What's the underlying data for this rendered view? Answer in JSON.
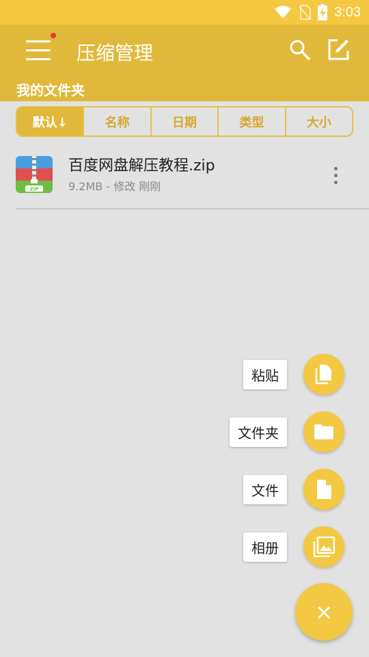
{
  "status_bar": {
    "time": "3:03",
    "icons": [
      "wifi-icon",
      "no-sim-icon",
      "battery-charging-icon"
    ]
  },
  "toolbar": {
    "title": "压缩管理",
    "icons": [
      "menu-icon",
      "search-icon",
      "edit-icon"
    ],
    "has_notification_dot": true
  },
  "breadcrumb": {
    "label": "我的文件夹"
  },
  "sort_tabs": [
    {
      "label": "默认↓",
      "active": true
    },
    {
      "label": "名称",
      "active": false
    },
    {
      "label": "日期",
      "active": false
    },
    {
      "label": "类型",
      "active": false
    },
    {
      "label": "大小",
      "active": false
    }
  ],
  "files": [
    {
      "name": "百度网盘解压教程.zip",
      "size": "9.2MB",
      "separator": "-",
      "modified": "修改 刚刚",
      "icon": "zip-file-icon",
      "badge": "ZIP"
    }
  ],
  "fab_menu": [
    {
      "label": "粘贴",
      "icon": "paste-icon"
    },
    {
      "label": "文件夹",
      "icon": "folder-icon"
    },
    {
      "label": "文件",
      "icon": "file-icon"
    },
    {
      "label": "相册",
      "icon": "photo-album-icon"
    }
  ],
  "fab_main": {
    "symbol": "×",
    "icon": "close-icon"
  },
  "colors": {
    "accent": "#f3c843",
    "toolbar": "#e0b93a",
    "status_bar": "#f5c842",
    "background": "#e2e2e2"
  }
}
